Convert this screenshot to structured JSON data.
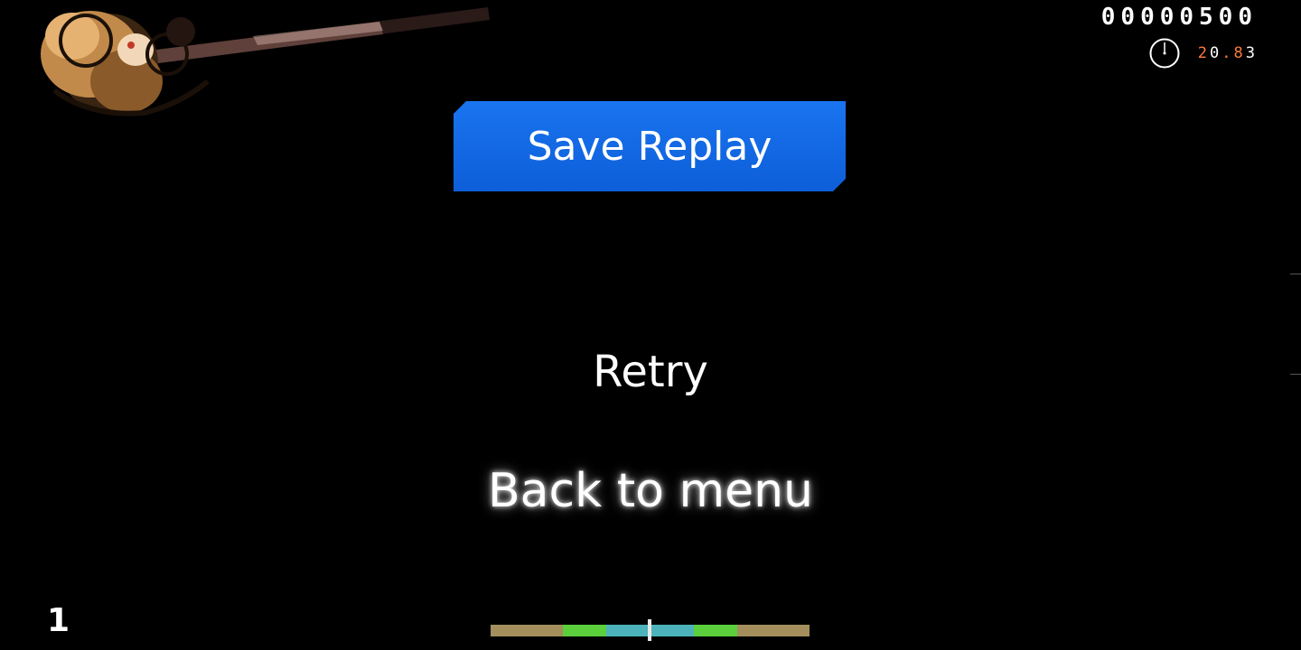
{
  "hud": {
    "score": "00000500",
    "accuracy_parts": [
      "2",
      "0",
      ".",
      "8",
      "3"
    ],
    "combo": "1",
    "health_fraction": 0.35
  },
  "pause_menu": {
    "save_replay_label": "Save Replay",
    "retry_label": "Retry",
    "back_label": "Back to menu"
  },
  "colors": {
    "save_button": "#1a74f0",
    "accuracy_highlight": "#ff7a3d",
    "hit_meh": "#a38e5c",
    "hit_ok": "#5bcf3c",
    "hit_great": "#4cb3bb"
  }
}
